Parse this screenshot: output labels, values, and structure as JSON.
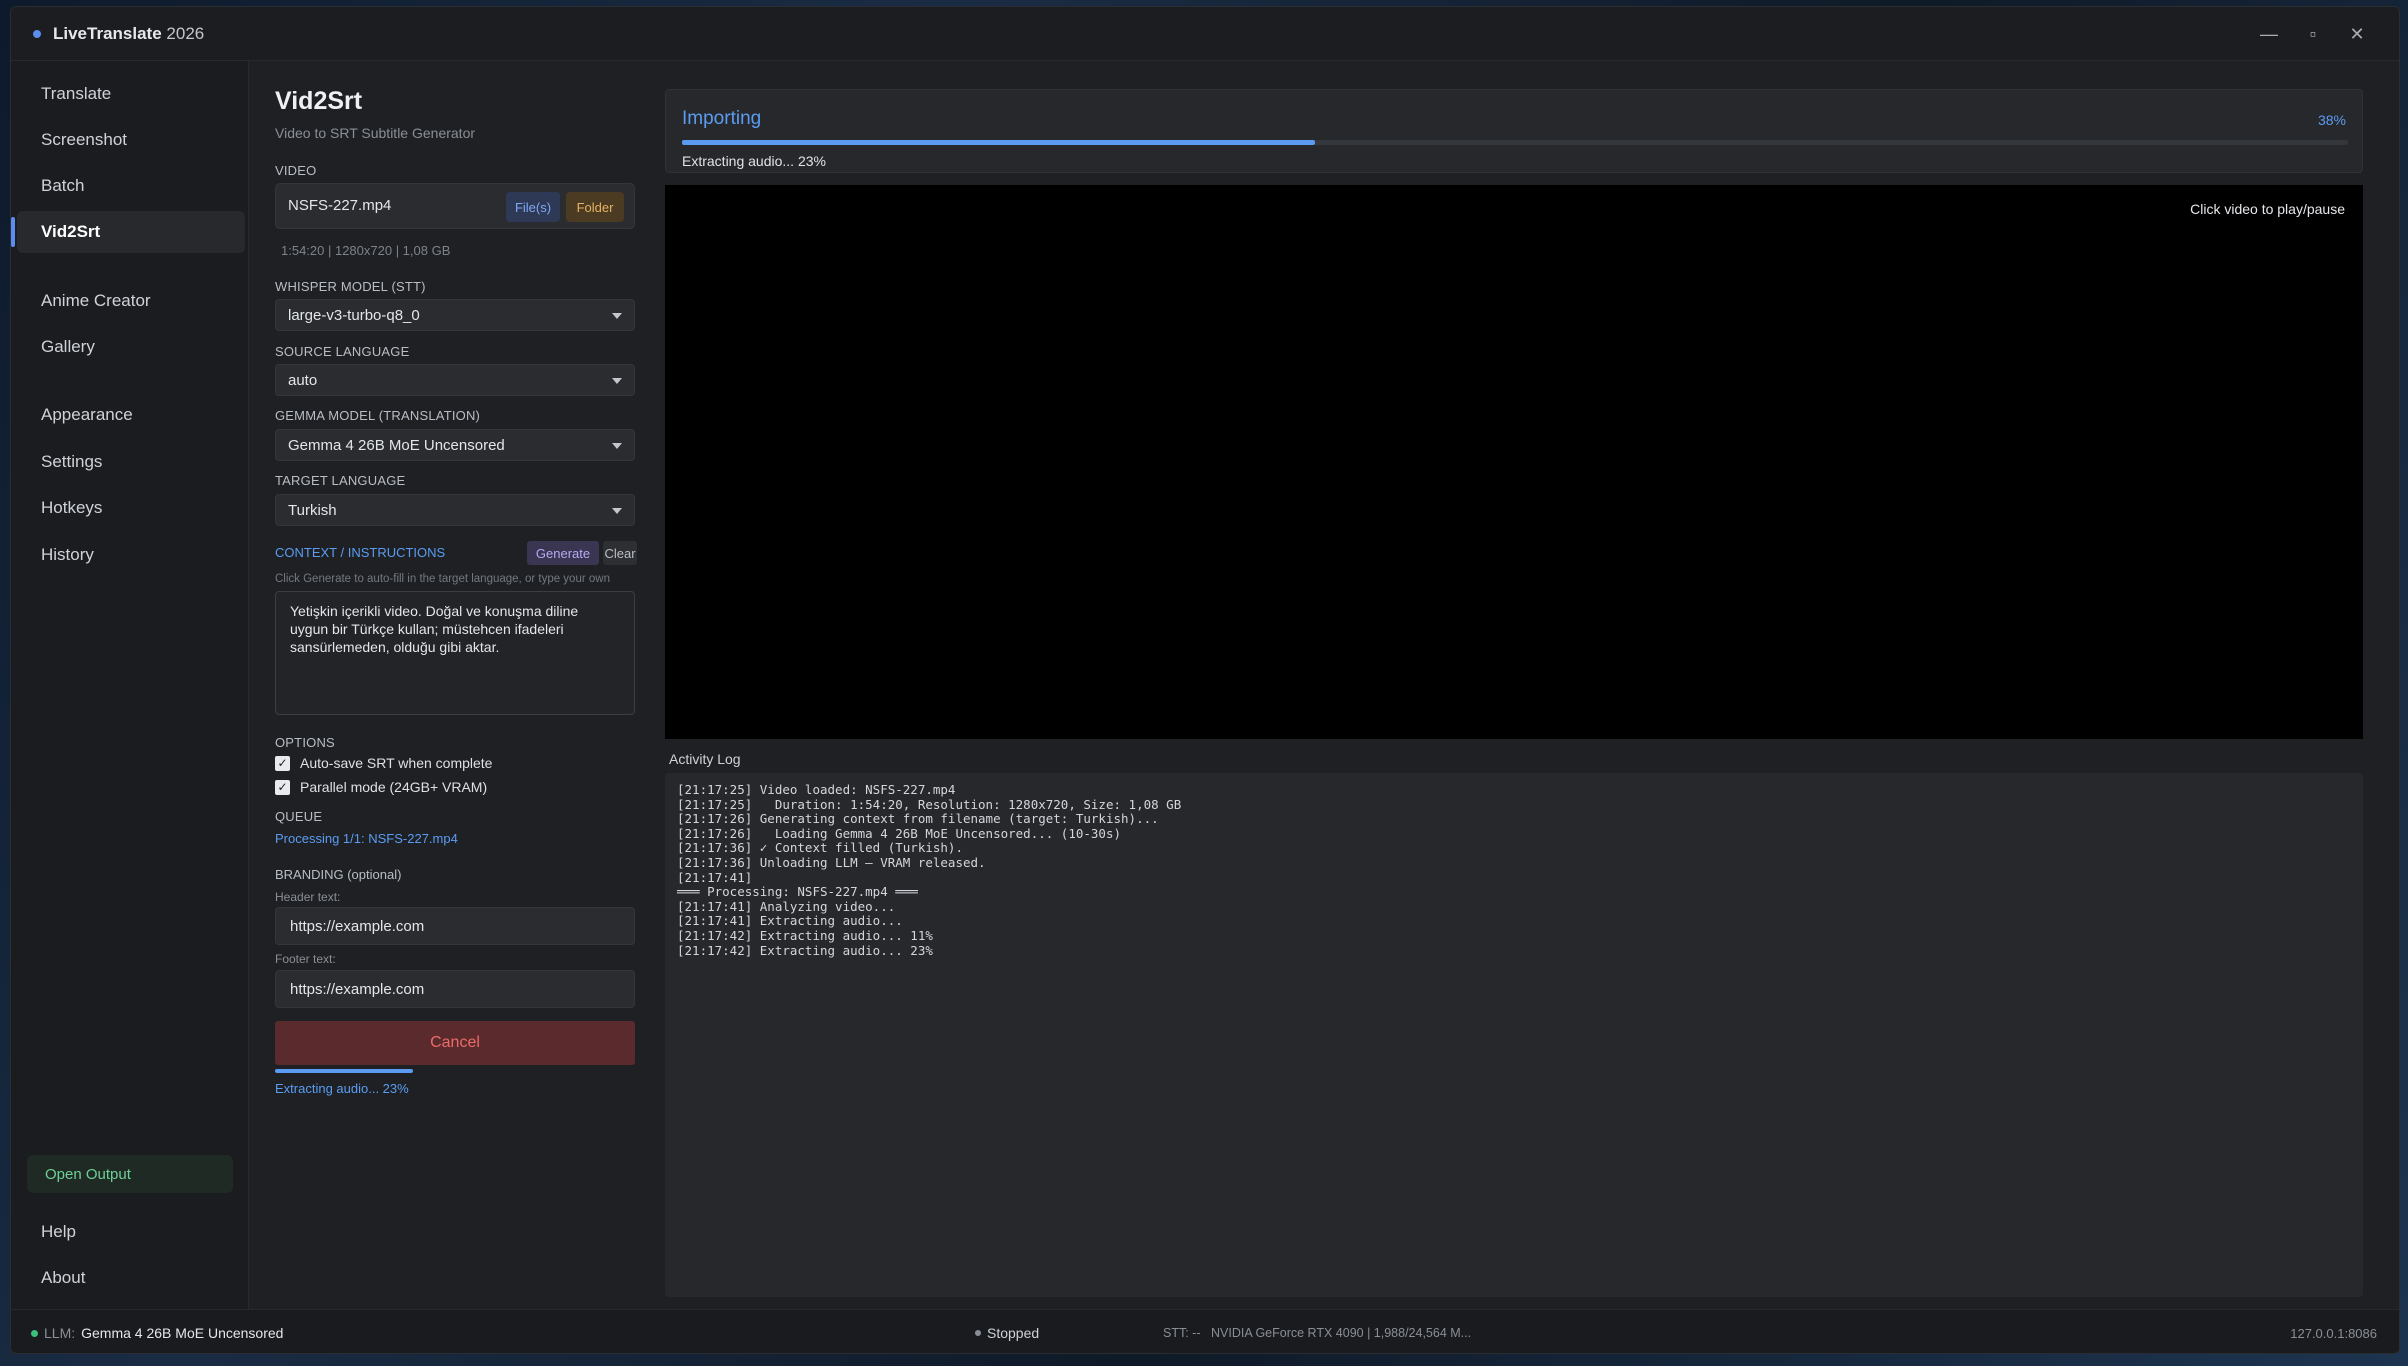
{
  "window": {
    "title": "LiveTranslate",
    "year": "2026",
    "controls": {
      "minimize": "—",
      "maximize": "▫",
      "close": "✕"
    }
  },
  "sidebar": {
    "items": [
      {
        "label": "Translate"
      },
      {
        "label": "Screenshot"
      },
      {
        "label": "Batch"
      },
      {
        "label": "Vid2Srt",
        "active": true
      },
      {
        "label": "Anime Creator"
      },
      {
        "label": "Gallery"
      },
      {
        "label": "Appearance"
      },
      {
        "label": "Settings"
      },
      {
        "label": "Hotkeys"
      },
      {
        "label": "History"
      }
    ],
    "open_output": "Open Output",
    "help": "Help",
    "about": "About"
  },
  "form": {
    "title": "Vid2Srt",
    "subtitle": "Video to SRT Subtitle Generator",
    "video_label": "VIDEO",
    "video_name": "NSFS-227.mp4",
    "files_button": "File(s)",
    "folder_button": "Folder",
    "video_meta": "1:54:20  |  1280x720  |  1,08 GB",
    "whisper_label": "WHISPER MODEL (STT)",
    "whisper_value": "large-v3-turbo-q8_0",
    "source_label": "SOURCE LANGUAGE",
    "source_value": "auto",
    "gemma_label": "GEMMA MODEL (Translation)",
    "gemma_value": "Gemma 4 26B MoE Uncensored",
    "target_label": "TARGET LANGUAGE",
    "target_value": "Turkish",
    "context_label": "CONTEXT / INSTRUCTIONS",
    "generate_button": "Generate",
    "clear_button": "Clear",
    "context_hint": "Click Generate to auto-fill in the target language, or type your own",
    "context_text": "Yetişkin içerikli video. Doğal ve konuşma diline uygun bir Türkçe kullan; müstehcen ifadeleri sansürlemeden, olduğu gibi aktar.",
    "options_label": "OPTIONS",
    "option_autosave": "Auto-save SRT when complete",
    "option_parallel": "Parallel mode (24GB+ VRAM)",
    "queue_label": "QUEUE",
    "queue_text": "Processing 1/1: NSFS-227.mp4",
    "branding_label": "BRANDING (optional)",
    "header_label": "Header text:",
    "header_value": "https://example.com",
    "footer_label": "Footer text:",
    "footer_value": "https://example.com",
    "cancel_button": "Cancel",
    "mini_status": "Extracting audio... 23%"
  },
  "importing": {
    "title": "Importing",
    "percent": "38%",
    "progress": 0.38,
    "status": "Extracting audio... 23%"
  },
  "video_hint": "Click video to play/pause",
  "log": {
    "label": "Activity Log",
    "lines": [
      "[21:17:25] Video loaded: NSFS-227.mp4",
      "[21:17:25]   Duration: 1:54:20, Resolution: 1280x720, Size: 1,08 GB",
      "[21:17:26] Generating context from filename (target: Turkish)...",
      "[21:17:26]   Loading Gemma 4 26B MoE Uncensored... (10-30s)",
      "[21:17:36] ✓ Context filled (Turkish).",
      "[21:17:36] Unloading LLM — VRAM released.",
      "[21:17:41]",
      "═══ Processing: NSFS-227.mp4 ═══",
      "[21:17:41] Analyzing video...",
      "[21:17:41] Extracting audio...",
      "[21:17:42] Extracting audio... 11%",
      "[21:17:42] Extracting audio... 23%"
    ]
  },
  "statusbar": {
    "llm_prefix": "LLM:",
    "llm_name": "Gemma 4 26B MoE Uncensored",
    "state": "Stopped",
    "stt": "STT: --",
    "gpu": "NVIDIA GeForce RTX 4090 | 1,988/24,564 M...",
    "address": "127.0.0.1:8086"
  },
  "colors": {
    "accent": "#5b9cf2",
    "cancel": "#ec6b6b",
    "folder": "#e6b262",
    "online": "#3bbf7a"
  }
}
